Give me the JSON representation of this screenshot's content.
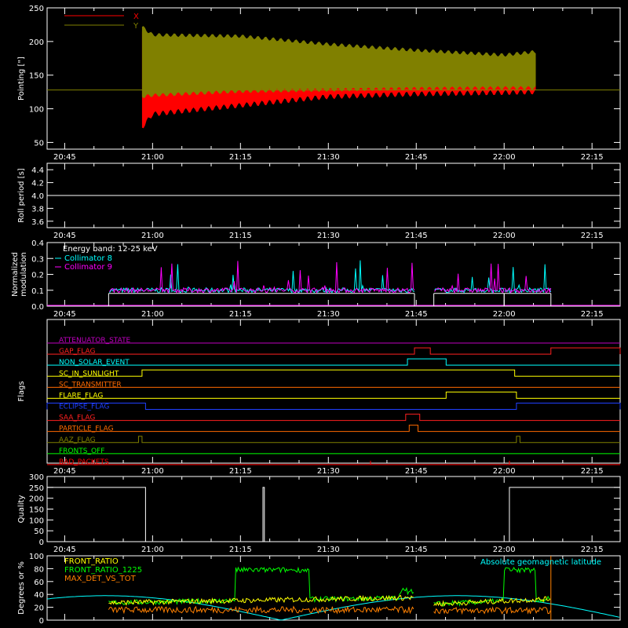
{
  "x_ticks": [
    "20:45",
    "21:00",
    "21:15",
    "21:30",
    "21:45",
    "22:00",
    "22:15"
  ],
  "chart_data": [
    {
      "type": "area",
      "id": "pointing",
      "ylabel": "Pointing [\"]",
      "ylim": [
        40,
        250
      ],
      "y_ticks": [
        "50",
        "100",
        "150",
        "200",
        "250"
      ],
      "legend": [
        {
          "label": "X",
          "color": "#ff0000"
        },
        {
          "label": "Y",
          "color": "#808000"
        }
      ],
      "series": [
        {
          "name": "X",
          "color": "#ff0000",
          "x": [
            20.97,
            21.0,
            21.25,
            21.5,
            21.75,
            22.0,
            22.09
          ],
          "low": [
            72,
            92,
            105,
            118,
            122,
            124,
            125
          ],
          "high": [
            215,
            200,
            192,
            182,
            175,
            172,
            178
          ]
        },
        {
          "name": "Y",
          "color": "#808000",
          "x": [
            20.97,
            21.0,
            21.25,
            21.5,
            21.75,
            22.0,
            22.09
          ],
          "low": [
            118,
            120,
            126,
            128,
            130,
            131,
            131
          ],
          "high": [
            222,
            210,
            208,
            196,
            187,
            180,
            185
          ]
        }
      ],
      "reference_line": 128
    },
    {
      "type": "line",
      "id": "roll",
      "ylabel": "Roll period [s]",
      "ylim": [
        3.5,
        4.5
      ],
      "y_ticks": [
        "3.6",
        "3.8",
        "4.0",
        "4.2",
        "4.4"
      ],
      "constant": 4.0
    },
    {
      "type": "line",
      "id": "modulation",
      "ylabel": "Normalized modulation",
      "ylim": [
        0,
        0.4
      ],
      "y_ticks": [
        "0.0",
        "0.1",
        "0.2",
        "0.3",
        "0.4"
      ],
      "annotation": "Energy band: 12-25 keV",
      "legend": [
        {
          "label": "Collimator 8",
          "color": "#00ffff"
        },
        {
          "label": "Collimator 9",
          "color": "#ff00ff"
        }
      ],
      "intervals": [
        [
          20.875,
          21.745
        ],
        [
          21.8,
          22.0
        ],
        [
          22.0,
          22.133
        ]
      ],
      "baseline": 0.08,
      "level": 0.1
    },
    {
      "type": "line",
      "id": "flags",
      "ylabel": "Flags",
      "flags": [
        {
          "name": "ATTENUATOR_STATE",
          "color": "#c000c0",
          "high": []
        },
        {
          "name": "GAP_FLAG",
          "color": "#ff2020",
          "high": [
            [
              21.745,
              21.79
            ],
            [
              22.133,
              22.33
            ]
          ]
        },
        {
          "name": "NON_SOLAR_EVENT",
          "color": "#00ffff",
          "high": [
            [
              21.725,
              21.835
            ]
          ]
        },
        {
          "name": "SC_IN_SUNLIGHT",
          "color": "#ffff00",
          "high": [
            [
              20.97,
              22.03
            ]
          ]
        },
        {
          "name": "SC_TRANSMITTER",
          "color": "#ff6a00",
          "high": []
        },
        {
          "name": "FLARE_FLAG",
          "color": "#ffff00",
          "high": [
            [
              21.835,
              22.035
            ]
          ]
        },
        {
          "name": "ECLIPSE_FLAG",
          "color": "#2040ff",
          "high": [
            [
              20.7,
              20.98
            ],
            [
              22.035,
              22.33
            ]
          ]
        },
        {
          "name": "SAA_FLAG",
          "color": "#ff2020",
          "high": [
            [
              21.72,
              21.76
            ]
          ]
        },
        {
          "name": "PARTICLE_FLAG",
          "color": "#ff6a00",
          "high": [
            [
              21.73,
              21.755
            ]
          ]
        },
        {
          "name": "AAZ_FLAG",
          "color": "#808000",
          "high": [
            [
              20.96,
              20.97
            ],
            [
              22.035,
              22.045
            ]
          ]
        },
        {
          "name": "FRONTS_OFF",
          "color": "#00ff00",
          "high": []
        },
        {
          "name": "BAD_PACKETS",
          "color": "#ff0000",
          "high": []
        }
      ]
    },
    {
      "type": "line",
      "id": "quality",
      "ylabel": "Quality",
      "ylim": [
        0,
        300
      ],
      "y_ticks": [
        "0",
        "50",
        "100",
        "150",
        "200",
        "250",
        "300"
      ],
      "steps": [
        [
          20.7,
          250
        ],
        [
          20.98,
          0
        ],
        [
          21.314,
          250
        ],
        [
          21.318,
          0
        ],
        [
          22.015,
          250
        ],
        [
          22.33,
          250
        ]
      ]
    },
    {
      "type": "line",
      "id": "lastpanel",
      "ylabel": "Degrees or %",
      "ylim": [
        0,
        100
      ],
      "y_ticks": [
        "0",
        "20",
        "40",
        "60",
        "80",
        "100"
      ],
      "legend": [
        {
          "label": "FRONT_RATIO",
          "color": "#ffff00"
        },
        {
          "label": "FRONT_RATIO_1225",
          "color": "#00ff00"
        },
        {
          "label": "MAX_DET_VS_TOT",
          "color": "#ff8000"
        }
      ],
      "right_legend": {
        "label": "Absolute geomagnetic latitude",
        "color": "#00ffff"
      }
    }
  ]
}
